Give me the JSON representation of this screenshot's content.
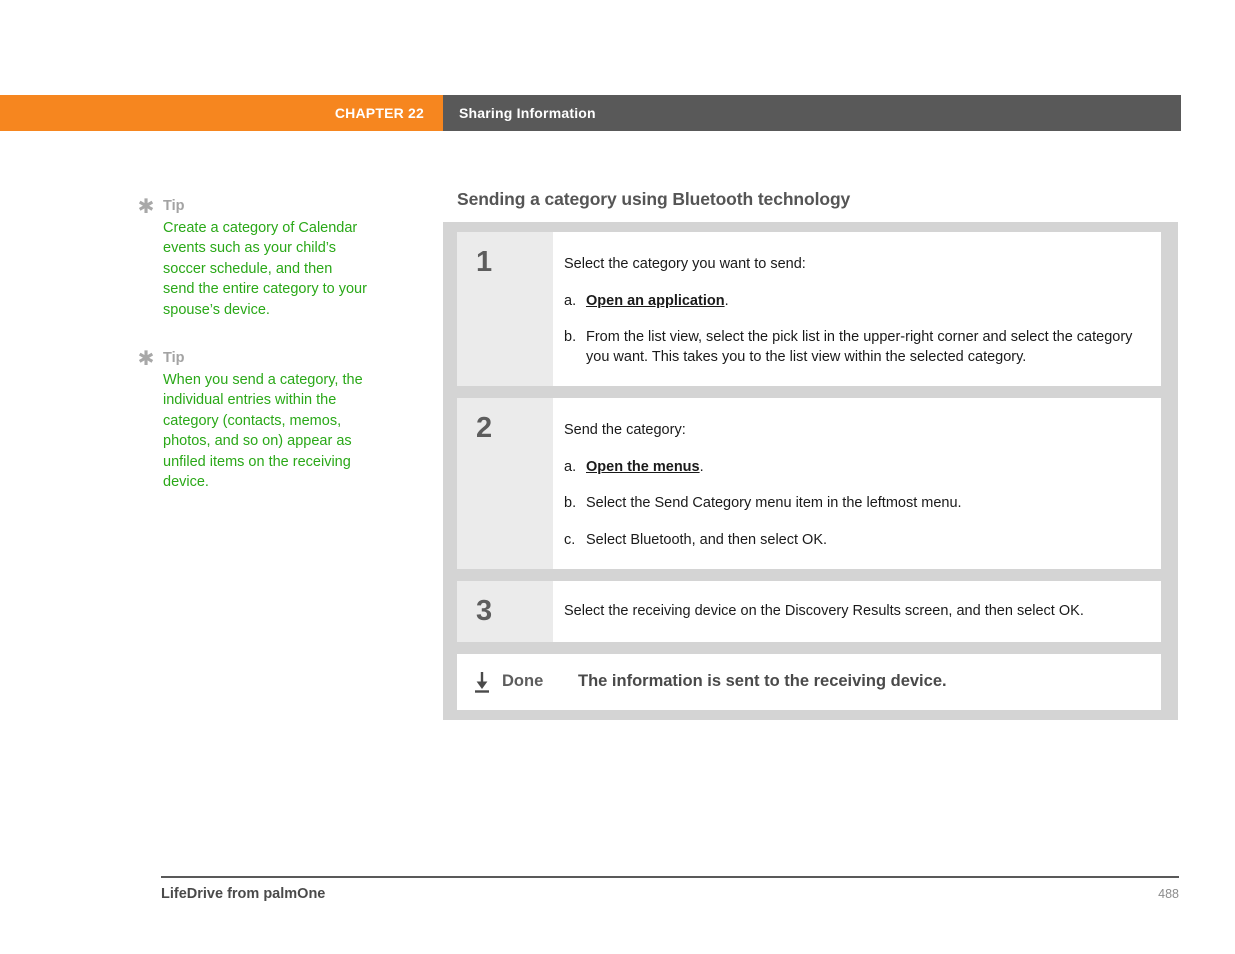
{
  "header": {
    "chapter": "CHAPTER 22",
    "section": "Sharing Information",
    "chapter_bg": "#f6861f",
    "section_bg": "#595959"
  },
  "sidebar": {
    "tips": [
      {
        "icon": "asterisk-icon",
        "label": "Tip",
        "text": "Create a category of Calendar events such as your child’s soccer schedule, and then send the entire category to your spouse’s device."
      },
      {
        "icon": "asterisk-icon",
        "label": "Tip",
        "text": "When you send a category, the individual entries within the category (contacts, memos, photos, and so on) appear as unfiled items on the receiving device."
      }
    ],
    "tip_text_color": "#2aa818",
    "tip_label_color": "#a3a3a3"
  },
  "main": {
    "heading": "Sending a category using Bluetooth technology",
    "steps": [
      {
        "number": "1",
        "lead": "Select the category you want to send:",
        "substeps": [
          {
            "marker": "a.",
            "link": "Open an application",
            "text": "."
          },
          {
            "marker": "b.",
            "text": "From the list view, select the pick list in the upper-right corner and select the category you want. This takes you to the list view within the selected category."
          }
        ]
      },
      {
        "number": "2",
        "lead": "Send the category:",
        "substeps": [
          {
            "marker": "a.",
            "link": "Open the menus",
            "text": "."
          },
          {
            "marker": "b.",
            "text": "Select the Send Category menu item in the leftmost menu."
          },
          {
            "marker": "c.",
            "text": "Select Bluetooth, and then select OK."
          }
        ]
      },
      {
        "number": "3",
        "lead": "Select the receiving device on the Discovery Results screen, and then select OK.",
        "substeps": []
      }
    ],
    "done": {
      "icon": "download-arrow-icon",
      "label": "Done",
      "text": "The information is sent to the receiving device."
    }
  },
  "footer": {
    "title": "LifeDrive from palmOne",
    "page": "488"
  }
}
